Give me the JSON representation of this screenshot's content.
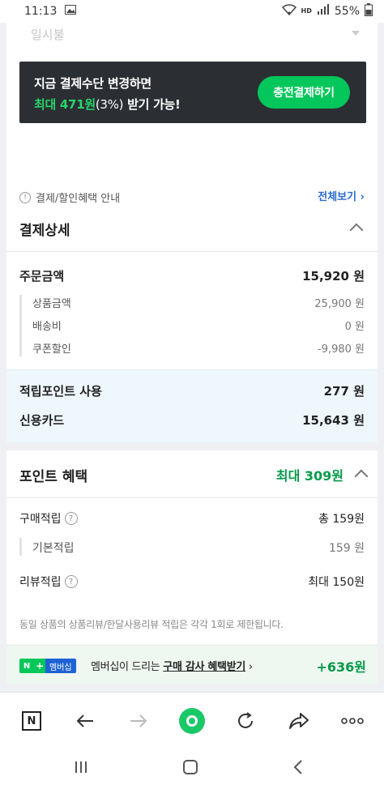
{
  "status_bar": {
    "time": "11:13",
    "hd": "HD",
    "battery": "55%"
  },
  "payment_card": {
    "select_value": "일시불",
    "promo_line1": "지금 결제수단 변경하면",
    "promo_line2_max": "최대 471원",
    "promo_line2_pct": "(3%)",
    "promo_line2_rest": " 받기 가능!",
    "promo_button": "충전결제하기",
    "notice": "결제/할인혜택 안내",
    "view_all": "전체보기"
  },
  "payment_details": {
    "title": "결제상세",
    "order_amount_label": "주문금액",
    "order_amount": "15,920 원",
    "items": [
      {
        "label": "상품금액",
        "value": "25,900 원"
      },
      {
        "label": "배송비",
        "value": "0 원"
      },
      {
        "label": "쿠폰할인",
        "value": "-9,980 원"
      }
    ],
    "points_used_label": "적립포인트 사용",
    "points_used": "277 원",
    "credit_card_label": "신용카드",
    "credit_card": "15,643 원"
  },
  "point_benefit": {
    "title": "포인트 혜택",
    "max_label": "최대 309원",
    "purchase_label": "구매적립",
    "purchase_value": "총 159원",
    "basic_label": "기본적립",
    "basic_value": "159 원",
    "review_label": "리뷰적립",
    "review_value": "최대 150원",
    "fine_print": "동일 상품의 상품리뷰/한달사용리뷰 적립은 각각 1회로 제한됩니다."
  },
  "membership": {
    "badge_n": "N",
    "badge_plus": "+",
    "badge_text": "멤버십",
    "text_prefix": "멤버십이 드리는 ",
    "text_link": "구매 감사 혜택받기",
    "points": "+636원"
  },
  "colors": {
    "naver_green": "#03c75a",
    "dark_promo": "#2b2e33",
    "link_blue": "#2a6ad1",
    "benefit_green": "#079a4a"
  },
  "icons": [
    "gallery-icon",
    "wifi-icon",
    "signal-icon",
    "battery-icon",
    "info-icon",
    "chevron-right-icon",
    "chevron-up-icon",
    "help-icon",
    "naver-n-icon",
    "back-arrow-icon",
    "forward-arrow-icon",
    "green-dot-icon",
    "refresh-icon",
    "share-icon",
    "more-icon",
    "recent-apps-icon",
    "home-icon",
    "back-nav-icon"
  ]
}
